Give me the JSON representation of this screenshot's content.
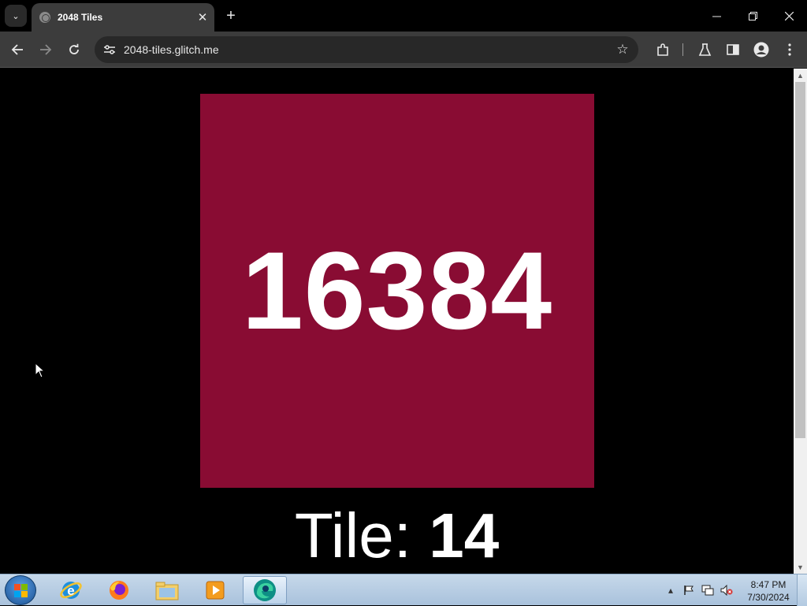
{
  "browser": {
    "tab": {
      "title": "2048 Tiles",
      "favicon": "globe-icon"
    },
    "url": "2048-tiles.glitch.me"
  },
  "page": {
    "tile_value": "16384",
    "tile_color": "#890c33",
    "caption_label": "Tile: ",
    "caption_value": "14"
  },
  "taskbar": {
    "apps": [
      "internet-explorer-icon",
      "firefox-icon",
      "file-explorer-icon",
      "media-player-icon",
      "edge-icon"
    ],
    "clock_time": "8:47 PM",
    "clock_date": "7/30/2024"
  },
  "colors": {
    "accent": "#890c33",
    "chrome_dark": "#3c3c3c"
  }
}
